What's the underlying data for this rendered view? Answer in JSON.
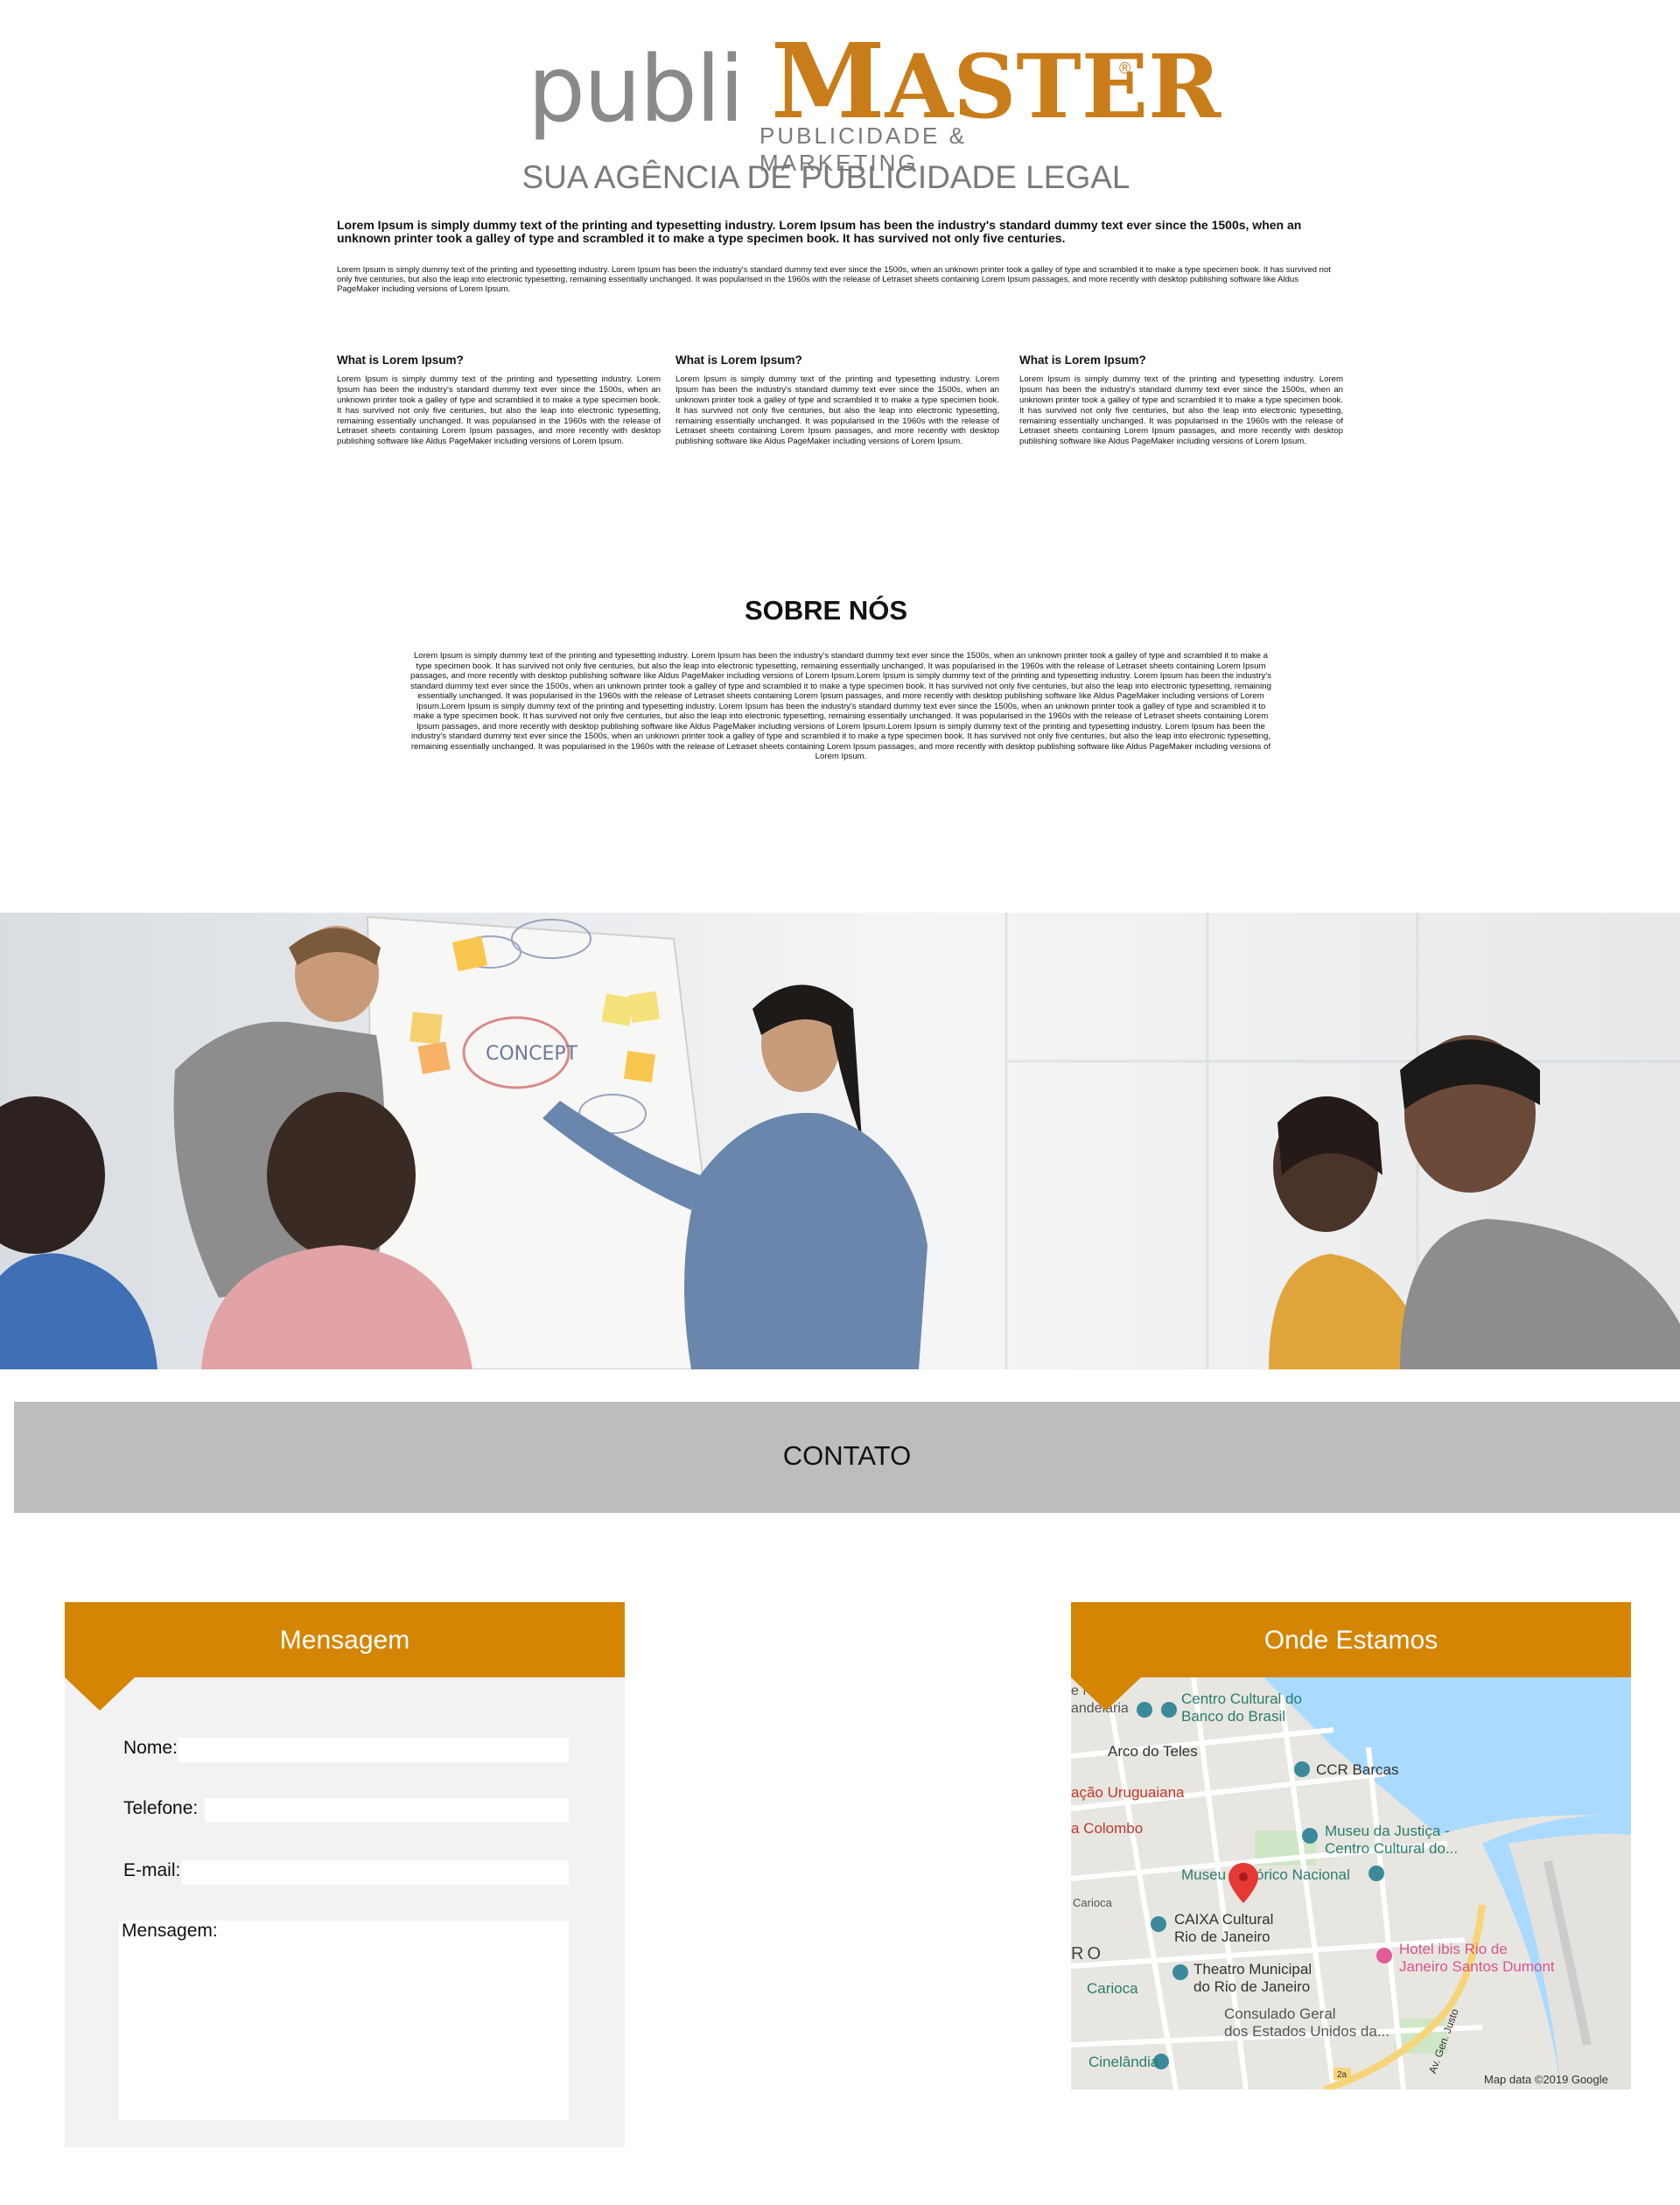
{
  "brand": {
    "logo_part1": "publi",
    "logo_part2_first": "M",
    "logo_part2_rest": "ASTER",
    "registered": "®",
    "subtitle": "PUBLICIDADE & MARKETING",
    "tagline": "SUA AGÊNCIA DE PUBLICIDADE LEGAL",
    "colors": {
      "orange": "#d58504",
      "grey": "#8a8a8a"
    }
  },
  "intro": {
    "bold_text": "Lorem Ipsum is simply dummy text of the printing and typesetting industry. Lorem Ipsum has been the industry's standard dummy text ever since the 1500s, when an unknown printer took a galley of type and scrambled it to make a type specimen book. It has survived not only five centuries.",
    "small_text": "Lorem Ipsum is simply dummy text of the printing and typesetting industry. Lorem Ipsum has been the industry's standard dummy text ever since the 1500s, when an unknown printer took a galley of type and scrambled it to make a type specimen book. It has survived not only five centuries, but also the leap into electronic typesetting, remaining essentially unchanged. It was popularised in the 1960s with the release of Letraset sheets containing Lorem Ipsum passages, and more recently with desktop publishing software like Aldus PageMaker including versions of Lorem Ipsum."
  },
  "columns": [
    {
      "title": "What is Lorem Ipsum?",
      "text": "Lorem Ipsum is simply dummy text of the printing and typesetting industry. Lorem Ipsum has been the industry's standard dummy text ever since the 1500s, when an unknown printer took a galley of type and scrambled it to make a type specimen book. It has survived not only five centuries, but also the leap into electronic typesetting, remaining essentially unchanged. It was popularised in the 1960s with the release of Letraset sheets containing Lorem Ipsum passages, and more recently with desktop publishing software like Aldus PageMaker including versions of Lorem Ipsum."
    },
    {
      "title": "What is Lorem Ipsum?",
      "text": "Lorem Ipsum is simply dummy text of the printing and typesetting industry. Lorem Ipsum has been the industry's standard dummy text ever since the 1500s, when an unknown printer took a galley of type and scrambled it to make a type specimen book. It has survived not only five centuries, but also the leap into electronic typesetting, remaining essentially unchanged. It was popularised in the 1960s with the release of Letraset sheets containing Lorem Ipsum passages, and more recently with desktop publishing software like Aldus PageMaker including versions of Lorem Ipsum."
    },
    {
      "title": "What is Lorem Ipsum?",
      "text": "Lorem Ipsum is simply dummy text of the printing and typesetting industry. Lorem Ipsum has been the industry's standard dummy text ever since the 1500s, when an unknown printer took a galley of type and scrambled it to make a type specimen book. It has survived not only five centuries, but also the leap into electronic typesetting, remaining essentially unchanged. It was popularised in the 1960s with the release of Letraset sheets containing Lorem Ipsum passages, and more recently with desktop publishing software like Aldus PageMaker including versions of Lorem Ipsum."
    }
  ],
  "about": {
    "title": "SOBRE NÓS",
    "text": "Lorem Ipsum is simply dummy text of the printing and typesetting industry. Lorem Ipsum has been the industry's standard dummy text ever since the 1500s, when an unknown printer took a galley of type and scrambled it to make a type specimen book. It has survived not only five centuries, but also the leap into electronic typesetting, remaining essentially unchanged. It was popularised in the 1960s with the release of Letraset sheets containing Lorem Ipsum passages, and more recently with desktop publishing software like Aldus PageMaker including versions of Lorem Ipsum.Lorem Ipsum is simply dummy text of the printing and typesetting industry. Lorem Ipsum has been the industry's standard dummy text ever since the 1500s, when an unknown printer took a galley of type and scrambled it to make a type specimen book. It has survived not only five centuries, but also the leap into electronic typesetting, remaining essentially unchanged. It was popularised in the 1960s with the release of Letraset sheets containing Lorem Ipsum passages, and more recently with desktop publishing software like Aldus PageMaker including versions of Lorem Ipsum.Lorem Ipsum is simply dummy text of the printing and typesetting industry. Lorem Ipsum has been the industry's standard dummy text ever since the 1500s, when an unknown printer took a galley of type and scrambled it to make a type specimen book. It has survived not only five centuries, but also the leap into electronic typesetting, remaining essentially unchanged. It was popularised in the 1960s with the release of Letraset sheets containing Lorem Ipsum passages, and more recently with desktop publishing software like Aldus PageMaker including versions of Lorem Ipsum.Lorem Ipsum is simply dummy text of the printing and typesetting industry. Lorem Ipsum has been the industry's standard dummy text ever since the 1500s, when an unknown printer took a galley of type and scrambled it to make a type specimen book. It has survived not only five centuries, but also the leap into electronic typesetting, remaining essentially unchanged. It was popularised in the 1960s with the release of Letraset sheets containing Lorem Ipsum passages, and more recently with desktop publishing software like Aldus PageMaker including versions of Lorem Ipsum."
  },
  "photo": {
    "whiteboard_text": "CONCEPT"
  },
  "contact": {
    "bar_title": "CONTATO",
    "form": {
      "title": "Mensagem",
      "name_label": "Nome:",
      "phone_label": "Telefone:",
      "email_label": "E-mail:",
      "message_label": "Mensagem:",
      "name_value": "",
      "phone_value": "",
      "email_value": "",
      "message_value": ""
    },
    "map": {
      "title": "Onde Estamos",
      "attribution": "Map data ©2019 Google",
      "labels": [
        "e Nossa",
        "andelária",
        "Centro Cultural do",
        "Banco do Brasil",
        "Arco do Teles",
        "CCR Barcas",
        "ação Uruguaiana",
        "a Colombo",
        "Museu da Justiça -",
        "Centro Cultural do...",
        "Museu Histórico Nacional",
        "Carioca",
        "CAIXA Cultural",
        "Rio de Janeiro",
        "RO",
        "Hotel ibis Rio de",
        "Janeiro Santos Dumont",
        "Carioca",
        "Theatro Municipal",
        "do Rio de Janeiro",
        "Consulado Geral",
        "dos Estados Unidos da...",
        "Cinelândia",
        "Av. Gen. Justo",
        "2a"
      ]
    }
  }
}
